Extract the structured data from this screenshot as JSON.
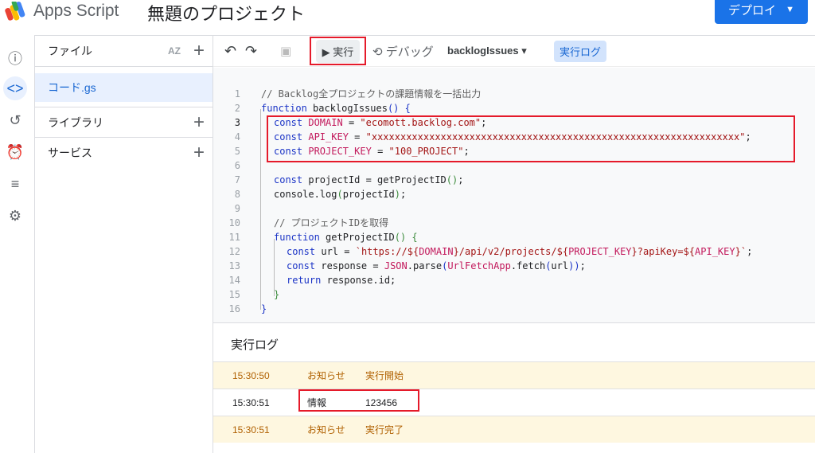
{
  "header": {
    "app_name": "Apps Script",
    "project_title": "無題のプロジェクト",
    "deploy_label": "デプロイ"
  },
  "sidebar": {
    "files_label": "ファイル",
    "file": "コード.gs",
    "libraries_label": "ライブラリ",
    "services_label": "サービス",
    "sort_label": "AZ"
  },
  "toolbar": {
    "run_label": "実行",
    "debug_label": "デバッグ",
    "function_select": "backlogIssues",
    "log_label": "実行ログ"
  },
  "code": {
    "lines": [
      [
        [
          "cm",
          "// Backlog全プロジェクトの課題情報を一括出力"
        ]
      ],
      [
        [
          "kw",
          "function "
        ],
        [
          "fn",
          "backlogIssues"
        ],
        [
          "kw",
          "() {"
        ]
      ],
      [
        [
          "kw",
          "const "
        ],
        [
          "var",
          "DOMAIN"
        ],
        [
          "fn",
          " = "
        ],
        [
          "str",
          "\"ecomott.backlog.com\""
        ],
        [
          "fn",
          ";"
        ]
      ],
      [
        [
          "kw",
          "const "
        ],
        [
          "var",
          "API_KEY"
        ],
        [
          "fn",
          " = "
        ],
        [
          "str",
          "\"xxxxxxxxxxxxxxxxxxxxxxxxxxxxxxxxxxxxxxxxxxxxxxxxxxxxxxxxxxxxxxxx\""
        ],
        [
          "fn",
          ";"
        ]
      ],
      [
        [
          "kw",
          "const "
        ],
        [
          "var",
          "PROJECT_KEY"
        ],
        [
          "fn",
          " = "
        ],
        [
          "str",
          "\"100_PROJECT\""
        ],
        [
          "fn",
          ";"
        ]
      ],
      [],
      [
        [
          "kw",
          "const "
        ],
        [
          "fn",
          "projectId = getProjectID"
        ],
        [
          "p",
          "()"
        ],
        [
          "fn",
          ";"
        ]
      ],
      [
        [
          "fn",
          "console.log"
        ],
        [
          "p",
          "("
        ],
        [
          "fn",
          "projectId"
        ],
        [
          "p",
          ")"
        ],
        [
          "fn",
          ";"
        ]
      ],
      [],
      [
        [
          "cm",
          "// プロジェクトIDを取得"
        ]
      ],
      [
        [
          "kw",
          "function "
        ],
        [
          "fn",
          "getProjectID"
        ],
        [
          "p",
          "() {"
        ]
      ],
      [
        [
          "kw",
          "const "
        ],
        [
          "fn",
          "url = "
        ],
        [
          "str",
          "`https://${"
        ],
        [
          "var",
          "DOMAIN"
        ],
        [
          "str",
          "}/api/v2/projects/${"
        ],
        [
          "var",
          "PROJECT_KEY"
        ],
        [
          "str",
          "}?apiKey=${"
        ],
        [
          "var",
          "API_KEY"
        ],
        [
          "str",
          "}`"
        ],
        [
          "fn",
          ";"
        ]
      ],
      [
        [
          "kw",
          "const "
        ],
        [
          "fn",
          "response = "
        ],
        [
          "obj",
          "JSON"
        ],
        [
          "fn",
          ".parse"
        ],
        [
          "kw",
          "("
        ],
        [
          "obj",
          "UrlFetchApp"
        ],
        [
          "fn",
          ".fetch"
        ],
        [
          "kw",
          "("
        ],
        [
          "fn",
          "url"
        ],
        [
          "kw",
          "))"
        ],
        [
          "fn",
          ";"
        ]
      ],
      [
        [
          "kw",
          "return "
        ],
        [
          "fn",
          "response.id;"
        ]
      ],
      [
        [
          "p",
          "}"
        ]
      ],
      [
        [
          "kw",
          "}"
        ]
      ]
    ]
  },
  "log": {
    "title": "実行ログ",
    "rows": [
      {
        "time": "15:30:50",
        "level": "お知らせ",
        "message": "実行開始"
      },
      {
        "time": "15:30:51",
        "level": "情報",
        "message": "123456"
      },
      {
        "time": "15:30:51",
        "level": "お知らせ",
        "message": "実行完了"
      }
    ]
  }
}
